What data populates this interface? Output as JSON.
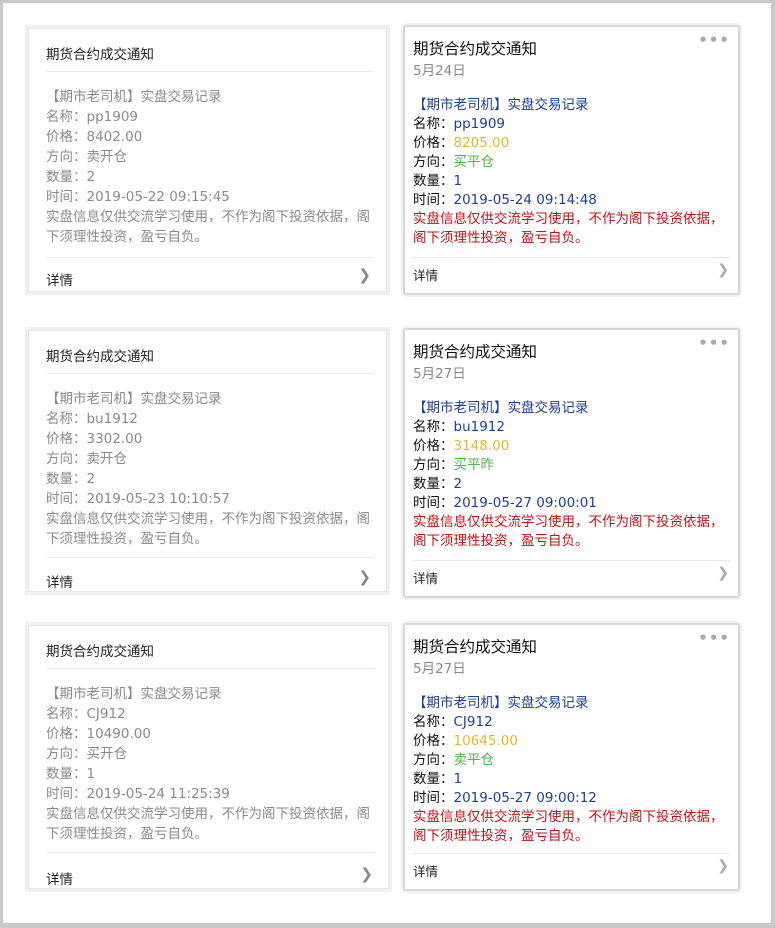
{
  "cards": [
    {
      "left": {
        "title": "期货合约成交通知",
        "head": "【期市老司机】实盘交易记录",
        "name": "名称：pp1909",
        "price": "价格：8402.00",
        "direction": "方向：卖开仓",
        "qty": "数量：2",
        "time": "时间：2019-05-22 09:15:45",
        "disclaimer": "实盘信息仅供交流学习使用，不作为阁下投资依据，阁下须理性投资，盈亏自负。",
        "detail": "详情"
      },
      "right": {
        "title": "期货合约成交通知",
        "date": "5月24日",
        "head": "【期市老司机】实盘交易记录",
        "name_key": "名称：",
        "name_val": "pp1909",
        "price_key": "价格：",
        "price_val": "8205.00",
        "dir_key": "方向：",
        "dir_val": "买平仓",
        "qty_key": "数量：",
        "qty_val": "1",
        "time_key": "时间：",
        "time_val": "2019-05-24 09:14:48",
        "disclaimer": "实盘信息仅供交流学习使用，不作为阁下投资依据，阁下须理性投资，盈亏自负。",
        "detail": "详情"
      }
    },
    {
      "left": {
        "title": "期货合约成交通知",
        "head": "【期市老司机】实盘交易记录",
        "name": "名称：bu1912",
        "price": "价格：3302.00",
        "direction": "方向：卖开仓",
        "qty": "数量：2",
        "time": "时间：2019-05-23 10:10:57",
        "disclaimer": "实盘信息仅供交流学习使用，不作为阁下投资依据，阁下须理性投资，盈亏自负。",
        "detail": "详情"
      },
      "right": {
        "title": "期货合约成交通知",
        "date": "5月27日",
        "head": "【期市老司机】实盘交易记录",
        "name_key": "名称：",
        "name_val": "bu1912",
        "price_key": "价格：",
        "price_val": "3148.00",
        "dir_key": "方向：",
        "dir_val": "买平昨",
        "qty_key": "数量：",
        "qty_val": "2",
        "time_key": "时间：",
        "time_val": "2019-05-27 09:00:01",
        "disclaimer": "实盘信息仅供交流学习使用，不作为阁下投资依据，阁下须理性投资，盈亏自负。",
        "detail": "详情"
      }
    },
    {
      "left": {
        "title": "期货合约成交通知",
        "head": "【期市老司机】实盘交易记录",
        "name": "名称：CJ912",
        "price": "价格：10490.00",
        "direction": "方向：买开仓",
        "qty": "数量：1",
        "time": "时间：2019-05-24 11:25:39",
        "disclaimer": "实盘信息仅供交流学习使用，不作为阁下投资依据，阁下须理性投资，盈亏自负。",
        "detail": "详情"
      },
      "right": {
        "title": "期货合约成交通知",
        "date": "5月27日",
        "head": "【期市老司机】实盘交易记录",
        "name_key": "名称：",
        "name_val": "CJ912",
        "price_key": "价格：",
        "price_val": "10645.00",
        "dir_key": "方向：",
        "dir_val": "卖平仓",
        "qty_key": "数量：",
        "qty_val": "1",
        "time_key": "时间：",
        "time_val": "2019-05-27 09:00:12",
        "disclaimer": "实盘信息仅供交流学习使用，不作为阁下投资依据，阁下须理性投资，盈亏自负。",
        "detail": "详情"
      }
    }
  ],
  "icons": {
    "chevron": "chevron-right-icon",
    "more": "more-dots-icon"
  },
  "colors": {
    "blue": "#1c3f8f",
    "yellow": "#e9b42b",
    "green": "#4fb34a",
    "red": "#c2101a",
    "gray_text": "#8a8a8a"
  }
}
